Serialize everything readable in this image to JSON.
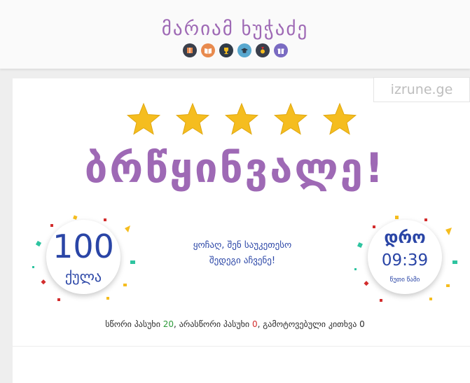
{
  "header": {
    "user_name": "მარიამ ხუჭაძე",
    "badges": [
      {
        "icon": "book-icon",
        "color": "#3a3f4b"
      },
      {
        "icon": "open-book-icon",
        "color": "#e88a4e"
      },
      {
        "icon": "trophy-icon",
        "color": "#2f3b48"
      },
      {
        "icon": "graduation-cap-icon",
        "color": "#58a8cf"
      },
      {
        "icon": "medal-icon",
        "color": "#3a3f4b"
      },
      {
        "icon": "gift-icon",
        "color": "#7a6bc2"
      }
    ]
  },
  "watermark": "izrune.ge",
  "result": {
    "stars_filled": 5,
    "stars_total": 5,
    "title": "ბრწყინვალე!"
  },
  "score": {
    "value": "100",
    "label": "ქულა"
  },
  "time": {
    "title": "დრო",
    "value": "09:39",
    "unit": "წუთი წამი"
  },
  "message": {
    "line1": "ყოჩაღ, შენ საუკეთესო",
    "line2": "შედეგი აჩვენე!"
  },
  "summary": {
    "correct_label": "სწორი პასუხი",
    "correct_count": "20",
    "sep1": ",",
    "wrong_label": "არასწორი პასუხი",
    "wrong_count": "0",
    "sep2": ",",
    "skipped_label": "გამოტოვებული კითხვა",
    "skipped_count": "0"
  },
  "colors": {
    "accent_purple": "#9e69b5",
    "accent_blue": "#2a45a6",
    "star_gold": "#f5bd1f",
    "correct_green": "#2e9b3a",
    "wrong_red": "#d22d2d"
  }
}
